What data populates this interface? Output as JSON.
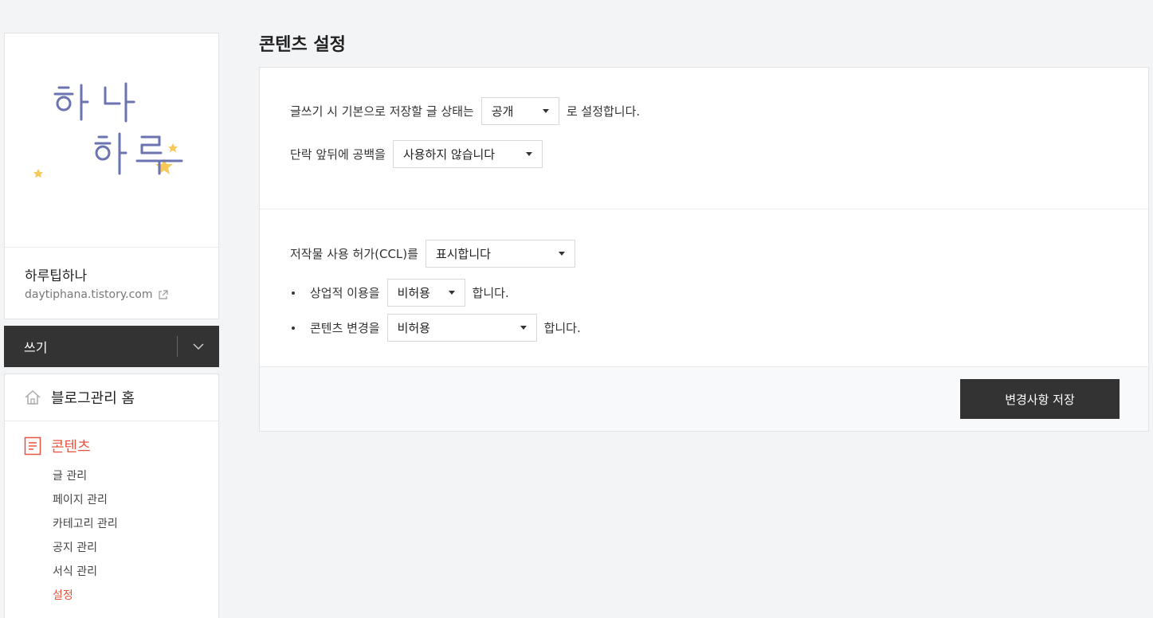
{
  "sidebar": {
    "blog_name": "하루팁하나",
    "blog_url": "daytiphana.tistory.com",
    "write_label": "쓰기",
    "home_label": "블로그관리 홈",
    "section_label": "콘텐츠",
    "submenu": [
      "글 관리",
      "페이지 관리",
      "카테고리 관리",
      "공지 관리",
      "서식 관리",
      "설정"
    ],
    "accent_color": "#e8533e"
  },
  "main": {
    "title": "콘텐츠 설정",
    "default_status": {
      "prefix": "글쓰기 시 기본으로 저장할 글 상태는",
      "value": "공개",
      "suffix": "로 설정합니다."
    },
    "paragraph_spacing": {
      "label": "단락 앞뒤에 공백을",
      "value": "사용하지 않습니다"
    },
    "ccl": {
      "label": "저작물 사용 허가(CCL)를",
      "value": "표시합니다",
      "commercial": {
        "label": "상업적 이용을",
        "value": "비허용",
        "suffix": "합니다."
      },
      "modification": {
        "label": "콘텐츠 변경을",
        "value": "비허용",
        "suffix": "합니다."
      }
    },
    "save_label": "변경사항 저장"
  }
}
